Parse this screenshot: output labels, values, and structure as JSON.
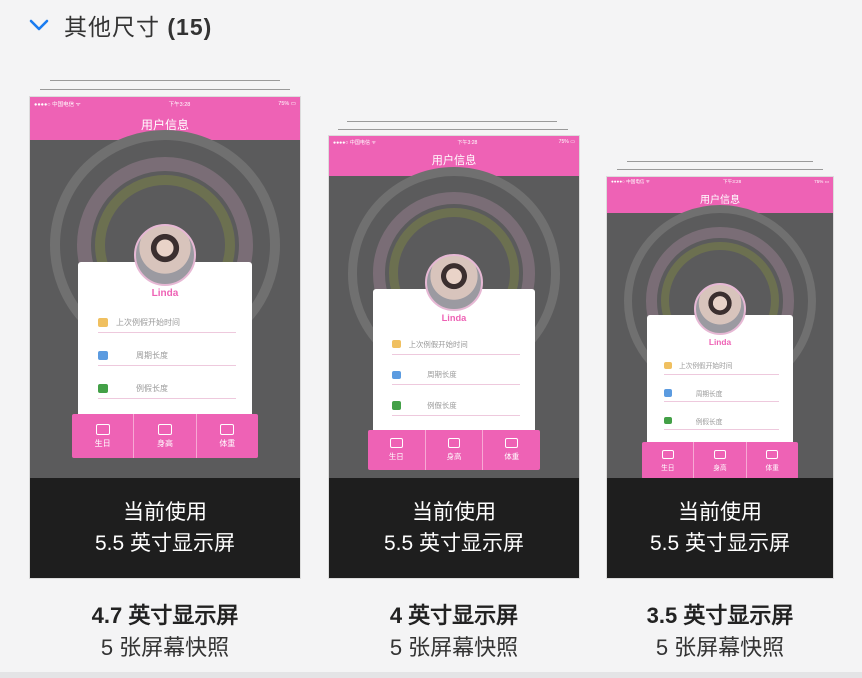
{
  "section": {
    "icon": "chevron-down-icon",
    "title": "其他尺寸",
    "count": "(15)",
    "accent": "#1a7cf0"
  },
  "app_screen": {
    "status_left": "●●●●○ 中国电信 ᯤ",
    "status_time": "下午3:28",
    "status_right": "75% ▭",
    "nav_title": "用户信息",
    "user_name": "Linda",
    "fields": [
      "上次例假开始时间",
      "周期长度",
      "例假长度"
    ],
    "tabs": [
      "生日",
      "身高",
      "体重"
    ],
    "brand_color": "#ee62b5"
  },
  "usage": {
    "line1": "当前使用",
    "line2": "5.5 英寸显示屏"
  },
  "devices": [
    {
      "title": "4.7 英寸显示屏",
      "subtitle": "5 张屏幕快照"
    },
    {
      "title": "4 英寸显示屏",
      "subtitle": "5 张屏幕快照"
    },
    {
      "title": "3.5 英寸显示屏",
      "subtitle": "5 张屏幕快照"
    }
  ]
}
